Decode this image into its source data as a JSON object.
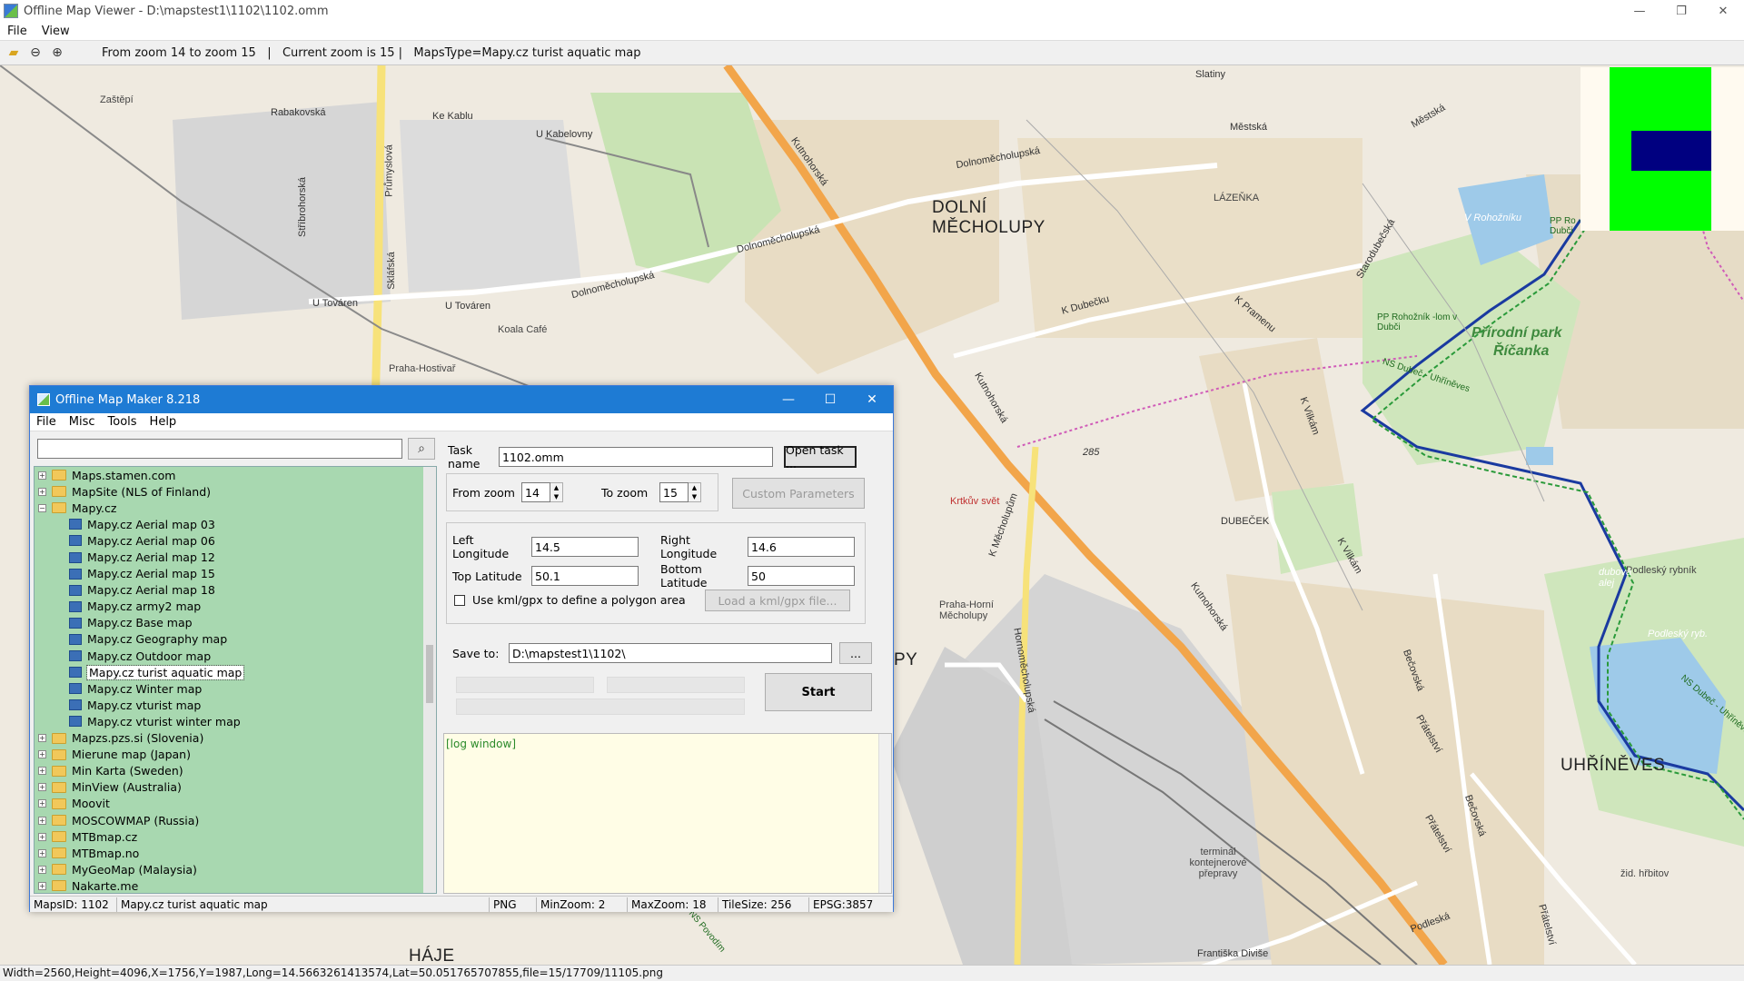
{
  "window": {
    "title": "Offline Map Viewer - D:\\mapstest1\\1102\\1102.omm",
    "controls": {
      "minimize": "—",
      "restore": "❐",
      "close": "✕"
    }
  },
  "menu": [
    "File",
    "View"
  ],
  "toolbar": {
    "info": "From zoom 14 to zoom 15   |   Current zoom is 15 |   MapsType=Mapy.cz turist aquatic map"
  },
  "map": {
    "labels": [
      {
        "text": "Zaštěpí",
        "cls": "ml-small"
      },
      {
        "text": "Rabakovská",
        "cls": "ml-road"
      },
      {
        "text": "Ke Kablu",
        "cls": "ml-road"
      },
      {
        "text": "U Kabelovny",
        "cls": "ml-road"
      },
      {
        "text": "Průmyslová",
        "cls": "ml-road"
      },
      {
        "text": "Stříbrohorská",
        "cls": "ml-road"
      },
      {
        "text": "Skláfská",
        "cls": "ml-road"
      },
      {
        "text": "U Továren",
        "cls": "ml-road"
      },
      {
        "text": "U Továren",
        "cls": "ml-road"
      },
      {
        "text": "Koala Café",
        "cls": "ml-small"
      },
      {
        "text": "Praha-Hostivař",
        "cls": "ml-small"
      },
      {
        "text": "Dolnoměcholupská",
        "cls": "ml-road"
      },
      {
        "text": "Dolnoměcholupská",
        "cls": "ml-road"
      },
      {
        "text": "Dolnoměcholupská",
        "cls": "ml-road"
      },
      {
        "text": "Slatiny",
        "cls": "ml-road"
      },
      {
        "text": "Kutnohorská",
        "cls": "ml-road"
      },
      {
        "text": "DOLNÍ",
        "cls": "ml-big"
      },
      {
        "text": "MĚCHOLUPY",
        "cls": "ml-big"
      },
      {
        "text": "Městská",
        "cls": "ml-road"
      },
      {
        "text": "Městská",
        "cls": "ml-road"
      },
      {
        "text": "LÁZEŇKA",
        "cls": "ml-small"
      },
      {
        "text": "Starodubečská",
        "cls": "ml-road"
      },
      {
        "text": "V Rohožníku",
        "cls": "ml-water"
      },
      {
        "text": "PP Ro -lom v Dubči",
        "cls": "ml-trail"
      },
      {
        "text": "PP Rohožník -lom v Dubči",
        "cls": "ml-trail"
      },
      {
        "text": "Přírodní park",
        "cls": "ml-green"
      },
      {
        "text": "Říčanka",
        "cls": "ml-green"
      },
      {
        "text": "NS Dubeč - Uhříněves",
        "cls": "ml-trail"
      },
      {
        "text": "K Dubečku",
        "cls": "ml-road"
      },
      {
        "text": "K Pramenu",
        "cls": "ml-road"
      },
      {
        "text": "K Vilkám",
        "cls": "ml-road"
      },
      {
        "text": "285",
        "cls": "ml-road"
      },
      {
        "text": "Kutnohorská",
        "cls": "ml-road"
      },
      {
        "text": "Krtkův svět",
        "cls": "ml-small"
      },
      {
        "text": "K Měcholupům",
        "cls": "ml-road"
      },
      {
        "text": "DUBEČEK",
        "cls": "ml-road"
      },
      {
        "text": "Kutnohorská",
        "cls": "ml-road"
      },
      {
        "text": "K Vilkám",
        "cls": "ml-road"
      },
      {
        "text": "Praha-Horní Měcholupy",
        "cls": "ml-small"
      },
      {
        "text": "Hornoměcholupská",
        "cls": "ml-road"
      },
      {
        "text": "PY",
        "cls": "ml-big"
      },
      {
        "text": "Podleský rybník",
        "cls": "ml-small"
      },
      {
        "text": "dubová alej",
        "cls": "ml-water"
      },
      {
        "text": "Podleský ryb.",
        "cls": "ml-water"
      },
      {
        "text": "NS Dubeč - Uhříněves",
        "cls": "ml-trail"
      },
      {
        "text": "UHŘÍNĚVES",
        "cls": "ml-big"
      },
      {
        "text": "Přátelství",
        "cls": "ml-road"
      },
      {
        "text": "Bečovská",
        "cls": "ml-road"
      },
      {
        "text": "Bečovská",
        "cls": "ml-road"
      },
      {
        "text": "Přátelství",
        "cls": "ml-road"
      },
      {
        "text": "terminál kontejnerové přepravy",
        "cls": "ml-small"
      },
      {
        "text": "Podleská",
        "cls": "ml-road"
      },
      {
        "text": "Františka Diviše",
        "cls": "ml-road"
      },
      {
        "text": "žid. hřbitov",
        "cls": "ml-small"
      },
      {
        "text": "Přátelství",
        "cls": "ml-road"
      },
      {
        "text": "NS Povodím",
        "cls": "ml-trail"
      },
      {
        "text": "HÁJE",
        "cls": "ml-big"
      }
    ]
  },
  "statusbar": "Width=2560,Height=4096,X=1756,Y=1987,Long=14.5663261413574,Lat=50.051765707855,file=15/17709/11105.png",
  "dialog": {
    "title": "Offline Map Maker 8.218",
    "controls": {
      "minimize": "—",
      "maximize": "☐",
      "close": "✕"
    },
    "menu": [
      "File",
      "Misc",
      "Tools",
      "Help"
    ],
    "search": {
      "value": "",
      "placeholder": ""
    },
    "tree": [
      {
        "label": "Maps.stamen.com",
        "type": "folder",
        "exp": "+"
      },
      {
        "label": "MapSite (NLS of Finland)",
        "type": "folder",
        "exp": "+"
      },
      {
        "label": "Mapy.cz",
        "type": "folder",
        "exp": "−"
      },
      {
        "label": "Mapy.cz Aerial map 03",
        "type": "map"
      },
      {
        "label": "Mapy.cz Aerial map 06",
        "type": "map"
      },
      {
        "label": "Mapy.cz Aerial map 12",
        "type": "map"
      },
      {
        "label": "Mapy.cz Aerial map 15",
        "type": "map"
      },
      {
        "label": "Mapy.cz Aerial map 18",
        "type": "map"
      },
      {
        "label": "Mapy.cz army2 map",
        "type": "map"
      },
      {
        "label": "Mapy.cz Base map",
        "type": "map"
      },
      {
        "label": "Mapy.cz Geography map",
        "type": "map"
      },
      {
        "label": "Mapy.cz Outdoor map",
        "type": "map"
      },
      {
        "label": "Mapy.cz turist aquatic map",
        "type": "map",
        "selected": true
      },
      {
        "label": "Mapy.cz Winter map",
        "type": "map"
      },
      {
        "label": "Mapy.cz vturist map",
        "type": "map"
      },
      {
        "label": "Mapy.cz vturist winter map",
        "type": "map"
      },
      {
        "label": "Mapzs.pzs.si (Slovenia)",
        "type": "folder",
        "exp": "+"
      },
      {
        "label": "Mierune map (Japan)",
        "type": "folder",
        "exp": "+"
      },
      {
        "label": "Min Karta (Sweden)",
        "type": "folder",
        "exp": "+"
      },
      {
        "label": "MinView (Australia)",
        "type": "folder",
        "exp": "+"
      },
      {
        "label": "Moovit",
        "type": "folder",
        "exp": "+"
      },
      {
        "label": "MOSCOWMAP (Russia)",
        "type": "folder",
        "exp": "+"
      },
      {
        "label": "MTBmap.cz",
        "type": "folder",
        "exp": "+"
      },
      {
        "label": "MTBmap.no",
        "type": "folder",
        "exp": "+"
      },
      {
        "label": "MyGeoMap (Malaysia)",
        "type": "folder",
        "exp": "+"
      },
      {
        "label": "Nakarte.me",
        "type": "folder",
        "exp": "+"
      }
    ],
    "form": {
      "task_label": "Task name",
      "task_value": "1102.omm",
      "open_task": "Open task ...",
      "from_zoom_label": "From zoom",
      "from_zoom": "14",
      "to_zoom_label": "To zoom",
      "to_zoom": "15",
      "custom_params": "Custom Parameters",
      "left_lon_label": "Left Longitude",
      "left_lon": "14.5",
      "right_lon_label": "Right Longitude",
      "right_lon": "14.6",
      "top_lat_label": "Top Latitude",
      "top_lat": "50.1",
      "bottom_lat_label": "Bottom Latitude",
      "bottom_lat": "50",
      "kml_label": "Use kml/gpx to define a polygon area",
      "load_kml": "Load a kml/gpx file...",
      "save_label": "Save to:",
      "save_value": "D:\\mapstest1\\1102\\",
      "browse": "...",
      "start": "Start"
    },
    "log": "[log window]",
    "status": {
      "maps_id": "MapsID: 1102",
      "maps_name": "Mapy.cz turist aquatic map",
      "format": "PNG",
      "min_zoom": "MinZoom: 2",
      "max_zoom": "MaxZoom: 18",
      "tile_size": "TileSize: 256",
      "epsg": "EPSG:3857"
    }
  }
}
